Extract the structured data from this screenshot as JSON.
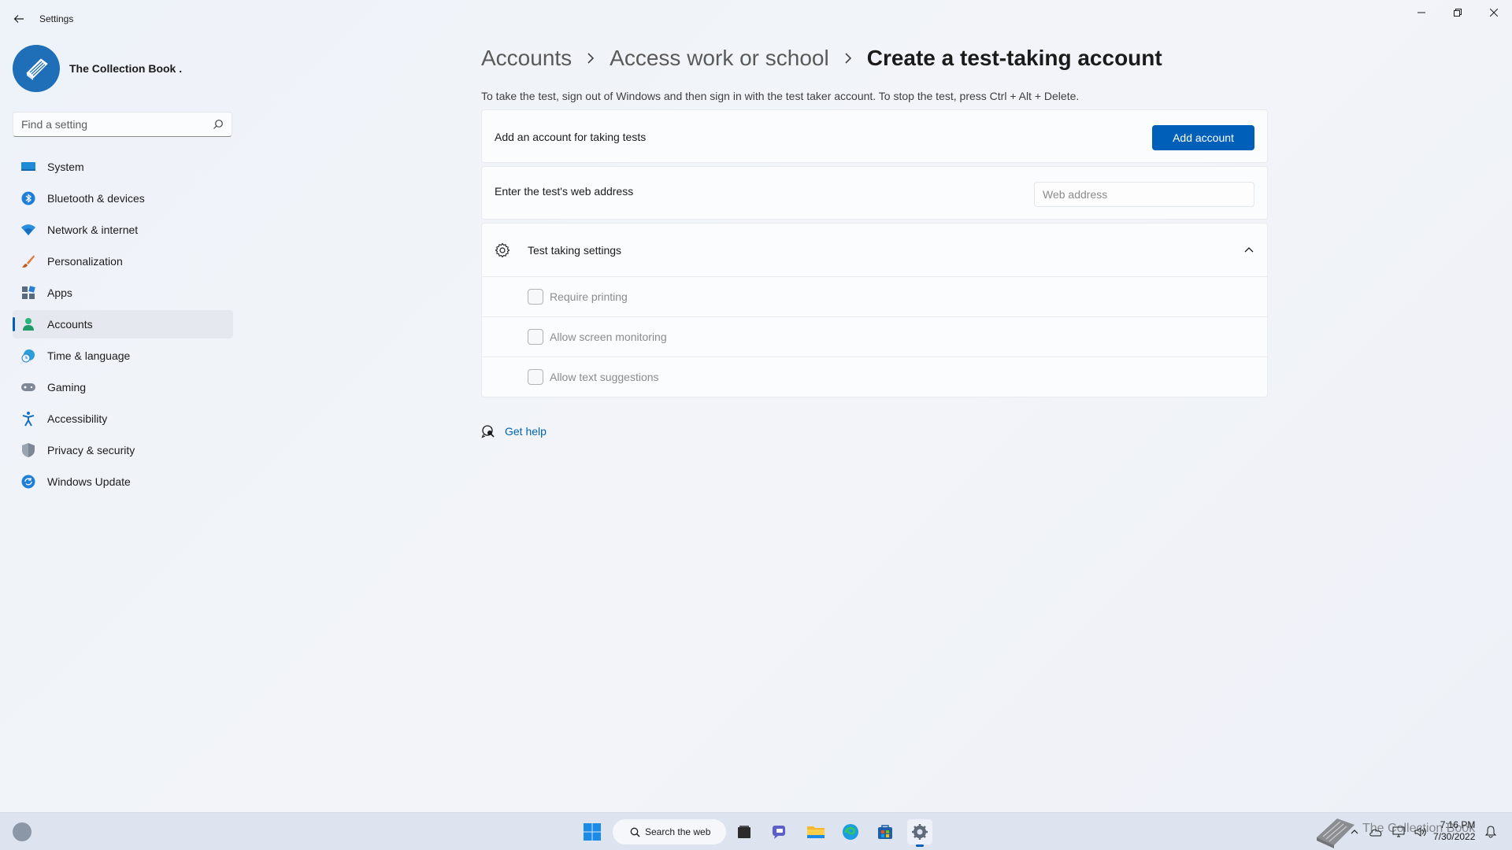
{
  "app": {
    "title": "Settings"
  },
  "profile": {
    "name": "The Collection Book ."
  },
  "search": {
    "placeholder": "Find a setting"
  },
  "sidebar": {
    "items": [
      {
        "label": "System",
        "icon": "system-icon"
      },
      {
        "label": "Bluetooth & devices",
        "icon": "bluetooth-icon"
      },
      {
        "label": "Network & internet",
        "icon": "wifi-icon"
      },
      {
        "label": "Personalization",
        "icon": "brush-icon"
      },
      {
        "label": "Apps",
        "icon": "apps-icon"
      },
      {
        "label": "Accounts",
        "icon": "accounts-icon",
        "active": true
      },
      {
        "label": "Time & language",
        "icon": "time-language-icon"
      },
      {
        "label": "Gaming",
        "icon": "gaming-icon"
      },
      {
        "label": "Accessibility",
        "icon": "accessibility-icon"
      },
      {
        "label": "Privacy & security",
        "icon": "shield-icon"
      },
      {
        "label": "Windows Update",
        "icon": "update-icon"
      }
    ]
  },
  "breadcrumb": {
    "items": [
      "Accounts",
      "Access work or school"
    ],
    "current": "Create a test-taking account"
  },
  "description": "To take the test, sign out of Windows and then sign in with the test taker account. To stop the test, press Ctrl + Alt + Delete.",
  "add_account": {
    "label": "Add an account for taking tests",
    "button": "Add account"
  },
  "web_address": {
    "label": "Enter the test's web address",
    "placeholder": "Web address"
  },
  "test_settings": {
    "title": "Test taking settings",
    "expanded": true,
    "options": [
      {
        "label": "Require printing",
        "checked": false
      },
      {
        "label": "Allow screen monitoring",
        "checked": false
      },
      {
        "label": "Allow text suggestions",
        "checked": false
      }
    ]
  },
  "help": {
    "label": "Get help"
  },
  "taskbar": {
    "search_label": "Search the web",
    "time": "7:16 PM",
    "date": "7/30/2022",
    "watermark": "The Collection Book"
  },
  "colors": {
    "accent": "#005fb8",
    "link": "#0063b1"
  }
}
